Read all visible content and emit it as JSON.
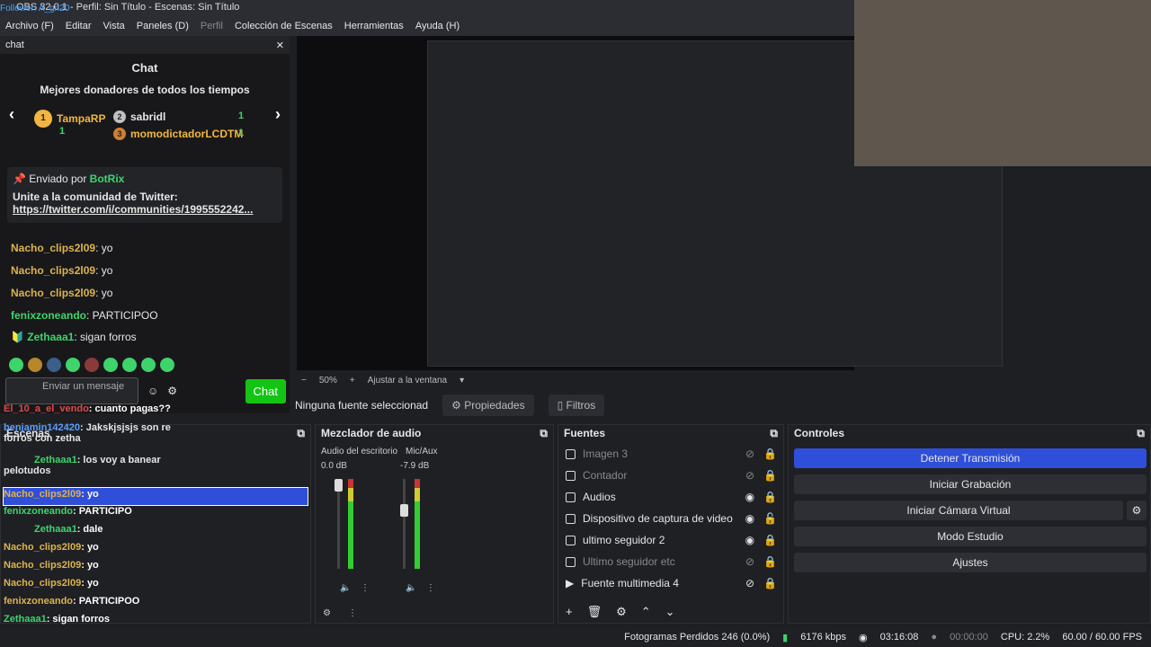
{
  "window": {
    "title": "OBS 32.0.1 - Perfil: Sin Título - Escenas: Sin Título",
    "ghost": "Follower: A_gri20"
  },
  "menu": [
    "Archivo (F)",
    "Editar",
    "Vista",
    "Paneles (D)",
    "Perfil",
    "Colección de Escenas",
    "Herramientas",
    "Ayuda (H)"
  ],
  "chat": {
    "dock_title": "chat",
    "title": "Chat",
    "donors_heading": "Mejores donadores de todos los tiempos",
    "donor1": {
      "rank": "1",
      "name": "TampaRP",
      "count": "1"
    },
    "donor2": {
      "rank": "2",
      "name": "sabridl",
      "count": "1"
    },
    "donor3": {
      "rank": "3",
      "name": "momodictadorLCDTM",
      "count": "1"
    },
    "pinned": {
      "by_label": "Enviado por",
      "by": "BotRix",
      "text": "Unite a la comunidad de Twitter:",
      "link": "https://twitter.com/i/communities/1995552242..."
    },
    "messages": [
      {
        "user": "Nacho_clips2l09",
        "text": ": yo"
      },
      {
        "user": "Nacho_clips2l09",
        "text": ": yo"
      },
      {
        "user": "Nacho_clips2l09",
        "text": ": yo"
      },
      {
        "user": "fenixzoneando",
        "text": ": PARTICIPOO"
      },
      {
        "user": "Zethaaa1",
        "text": ": sigan forros"
      }
    ],
    "input_placeholder": "Enviar un mensaje",
    "send": "Chat"
  },
  "preview": {
    "zoom": "50%",
    "fit": "Ajustar a la ventana"
  },
  "toolbar": {
    "no_source": "Ninguna fuente seleccionad",
    "properties": "Propiedades",
    "filters": "Filtros"
  },
  "scenes": {
    "title": "Escenas"
  },
  "overlay_chat": [
    {
      "user": "benjamin142420",
      "text": ": Jakskjsjsjs son re forros con zetha"
    },
    {
      "user": "Zethaaa1",
      "text": ": los voy a banear pelotudos"
    },
    {
      "user": "Nacho_clips2l09",
      "text": ": yo"
    },
    {
      "user": "fenixzoneando",
      "text": ": PARTICIPO"
    },
    {
      "user": "Zethaaa1",
      "text": ": dale"
    },
    {
      "user": "Nacho_clips2l09",
      "text": ": yo"
    },
    {
      "user": "Nacho_clips2l09",
      "text": ": yo"
    },
    {
      "user": "Nacho_clips2l09",
      "text": ": yo"
    },
    {
      "user": "fenixzoneando",
      "text": ": PARTICIPOO"
    },
    {
      "user": "Zethaaa1",
      "text": ": sigan forros"
    }
  ],
  "overlay_top": {
    "user": "El_10_a_el_vendo",
    "text": ": cuanto pagas??"
  },
  "mixer": {
    "title": "Mezclador de audio",
    "ch1": {
      "name": "Audio del escritorio",
      "db": "0.0 dB"
    },
    "ch2": {
      "name": "Mic/Aux",
      "db": "-7.9 dB"
    },
    "ticks": [
      "0",
      "-5",
      "-10",
      "-15",
      "-20",
      "-25",
      "-30",
      "-35",
      "-40",
      "-45",
      "-50",
      "-55",
      "-60"
    ]
  },
  "sources": {
    "title": "Fuentes",
    "items": [
      {
        "name": "Imagen 3",
        "dim": true
      },
      {
        "name": "Contador",
        "dim": true
      },
      {
        "name": "Audios",
        "dim": false
      },
      {
        "name": "Dispositivo de captura de video",
        "dim": false
      },
      {
        "name": "ultimo seguidor 2",
        "dim": false
      },
      {
        "name": "Ultimo seguidor etc",
        "dim": true
      },
      {
        "name": "Fuente multimedia 4",
        "dim": false
      }
    ]
  },
  "controls": {
    "title": "Controles",
    "stop_stream": "Detener Transmisión",
    "record": "Iniciar Grabación",
    "virtual_cam": "Iniciar Cámara Virtual",
    "studio": "Modo Estudio",
    "settings": "Ajustes"
  },
  "status": {
    "dropped": "Fotogramas Perdidos 246 (0.0%)",
    "bitrate": "6176 kbps",
    "stream_time": "03:16:08",
    "rec_time": "00:00:00",
    "cpu": "CPU: 2.2%",
    "fps": "60.00 / 60.00 FPS"
  },
  "colors": {
    "accent": "#2f4fd8",
    "chat_green": "#14c414"
  }
}
